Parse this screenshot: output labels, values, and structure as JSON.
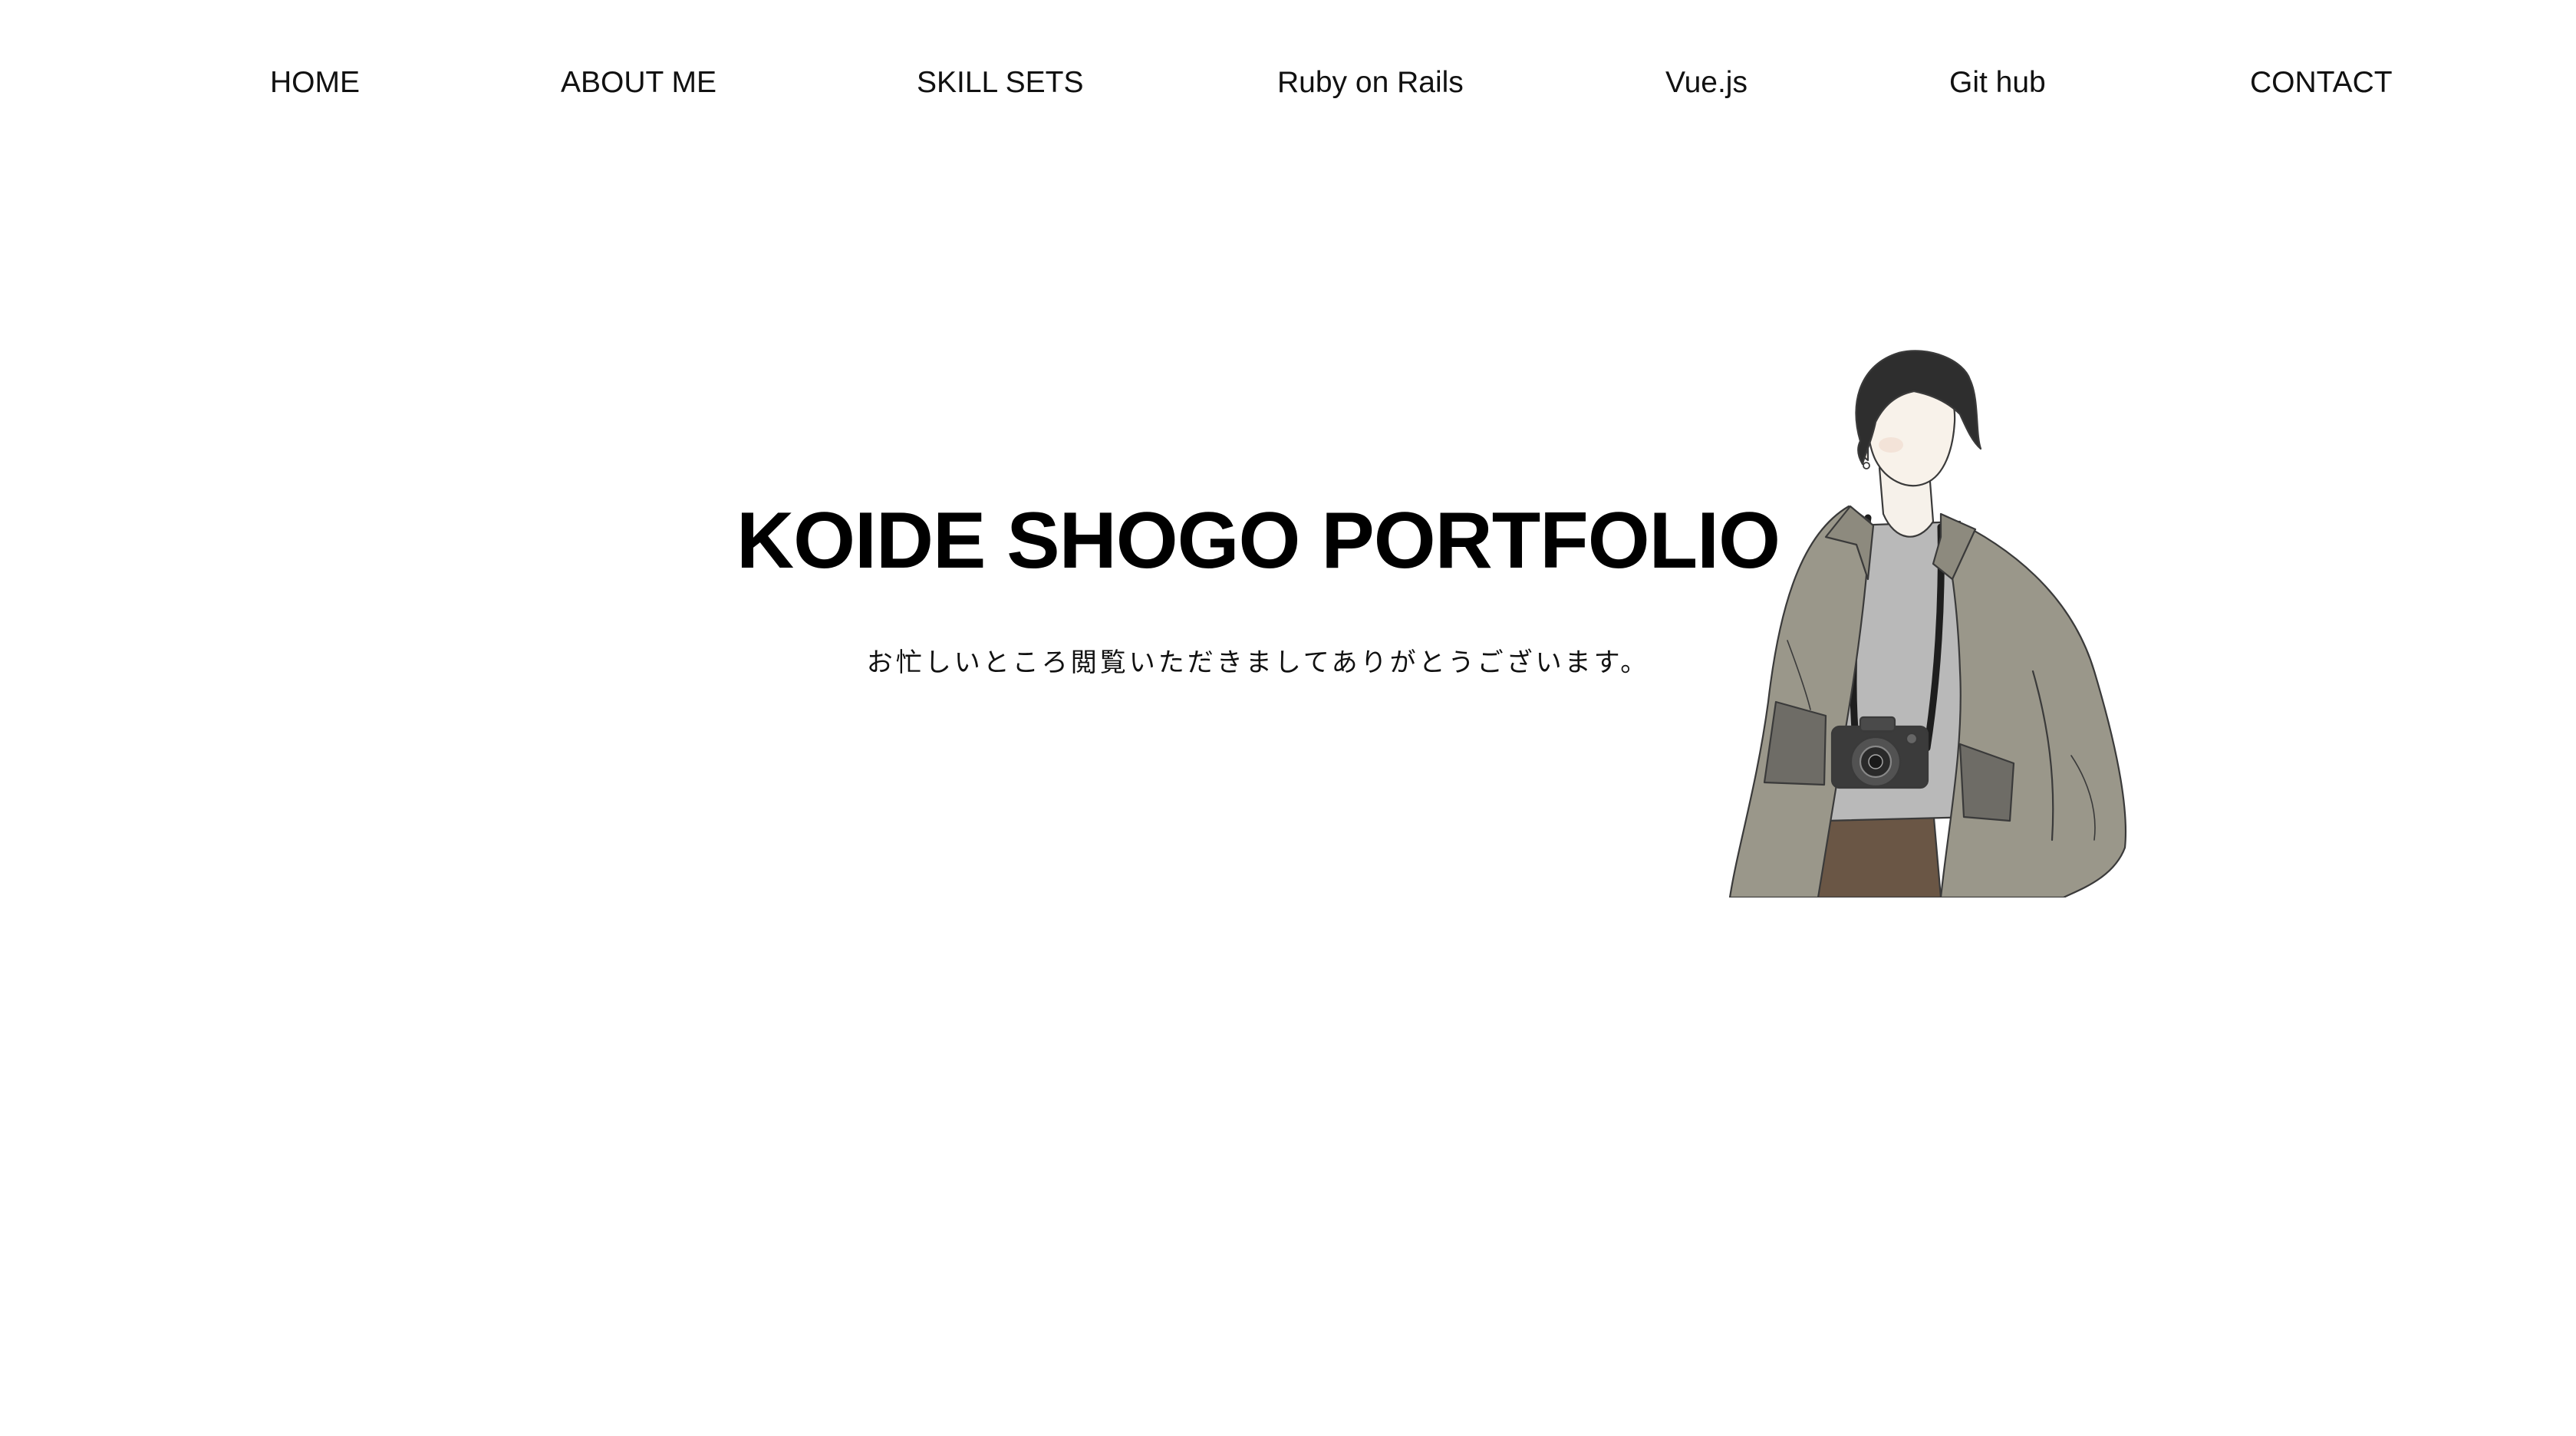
{
  "nav": {
    "items": [
      {
        "label": "HOME"
      },
      {
        "label": "ABOUT ME"
      },
      {
        "label": "SKILL SETS"
      },
      {
        "label": "Ruby on Rails"
      },
      {
        "label": "Vue.js"
      },
      {
        "label": "Git hub"
      },
      {
        "label": "CONTACT"
      }
    ]
  },
  "hero": {
    "title": "KOIDE SHOGO PORTFOLIO",
    "subtitle": "お忙しいところ閲覧いただきましてありがとうございます。"
  },
  "colors": {
    "background": "#ffffff",
    "text": "#111111",
    "jacket": "#9a978a",
    "hair": "#2e2e2e",
    "shirt": "#b9b9b9",
    "pants": "#6a5645"
  },
  "icons": {
    "portrait": "person-with-camera-illustration"
  }
}
